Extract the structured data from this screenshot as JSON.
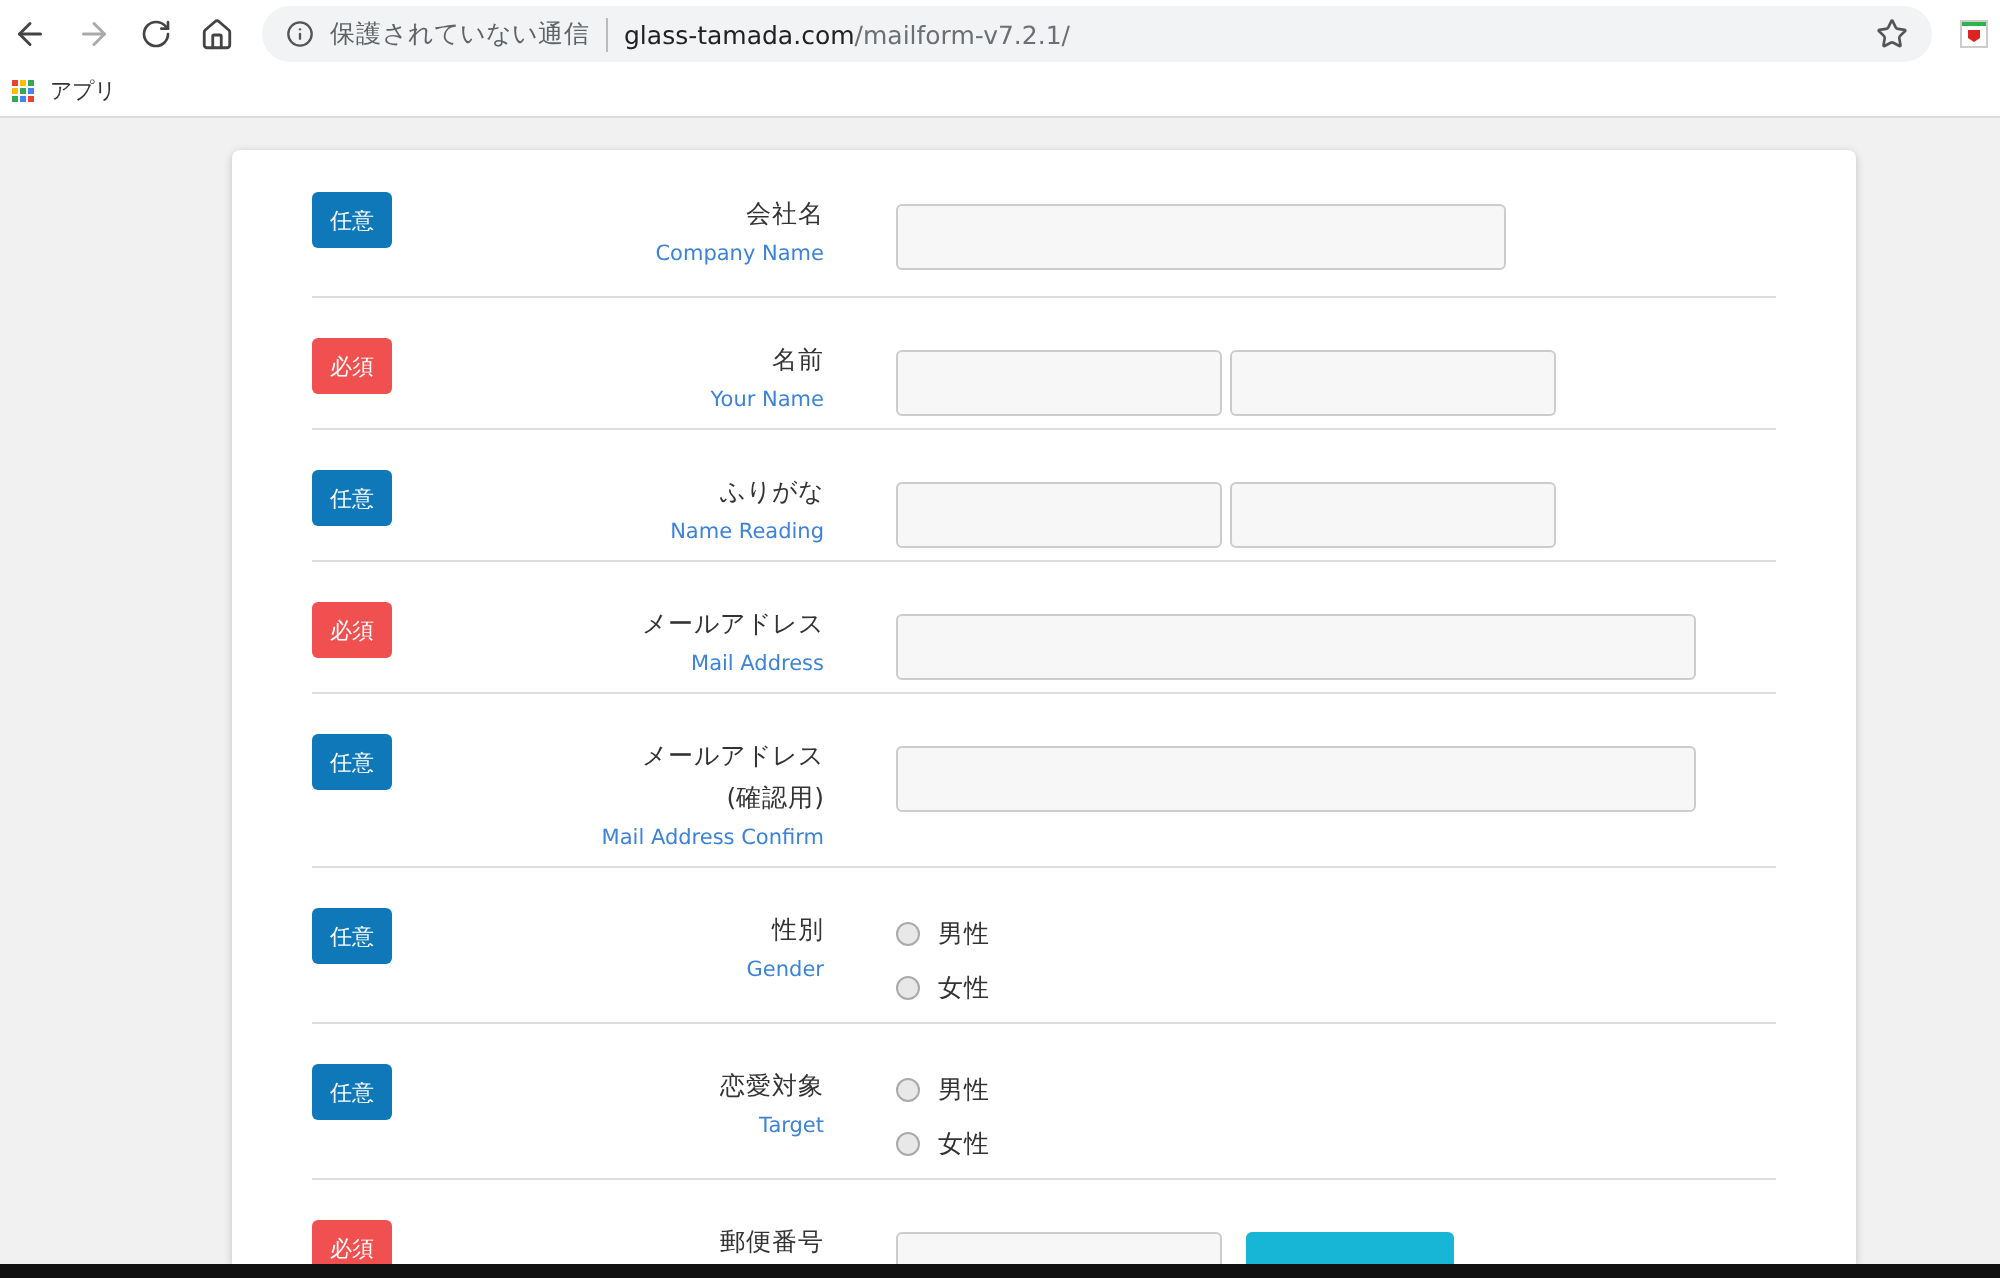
{
  "browser": {
    "security_label": "保護されていない通信",
    "url_domain": "glass-tamada.com",
    "url_path": "/mailform-v7.2.1/",
    "bookmarks": [
      {
        "label": "アプリ"
      }
    ]
  },
  "form": {
    "rows": [
      {
        "badge": {
          "label": "任意",
          "kind": "optional"
        },
        "label_lines": [
          "会社名"
        ],
        "label_en": "Company Name",
        "kind": "text-medium"
      },
      {
        "badge": {
          "label": "必須",
          "kind": "required"
        },
        "label_lines": [
          "名前"
        ],
        "label_en": "Your Name",
        "kind": "text-split"
      },
      {
        "badge": {
          "label": "任意",
          "kind": "optional"
        },
        "label_lines": [
          "ふりがな"
        ],
        "label_en": "Name Reading",
        "kind": "text-split"
      },
      {
        "badge": {
          "label": "必須",
          "kind": "required"
        },
        "label_lines": [
          "メールアドレス"
        ],
        "label_en": "Mail Address",
        "kind": "text-long"
      },
      {
        "badge": {
          "label": "任意",
          "kind": "optional"
        },
        "label_lines": [
          "メールアドレス",
          "(確認用)"
        ],
        "label_en": "Mail Address Confirm",
        "kind": "text-long"
      },
      {
        "badge": {
          "label": "任意",
          "kind": "optional"
        },
        "label_lines": [
          "性別"
        ],
        "label_en": "Gender",
        "kind": "radio",
        "options": [
          {
            "label": "男性",
            "selected": false
          },
          {
            "label": "女性",
            "selected": false
          }
        ]
      },
      {
        "badge": {
          "label": "任意",
          "kind": "optional"
        },
        "label_lines": [
          "恋愛対象"
        ],
        "label_en": "Target",
        "kind": "radio",
        "options": [
          {
            "label": "男性",
            "selected": false
          },
          {
            "label": "女性",
            "selected": false
          }
        ]
      },
      {
        "badge": {
          "label": "必須",
          "kind": "required"
        },
        "label_lines": [
          "郵便番号"
        ],
        "kind": "postal"
      }
    ]
  }
}
